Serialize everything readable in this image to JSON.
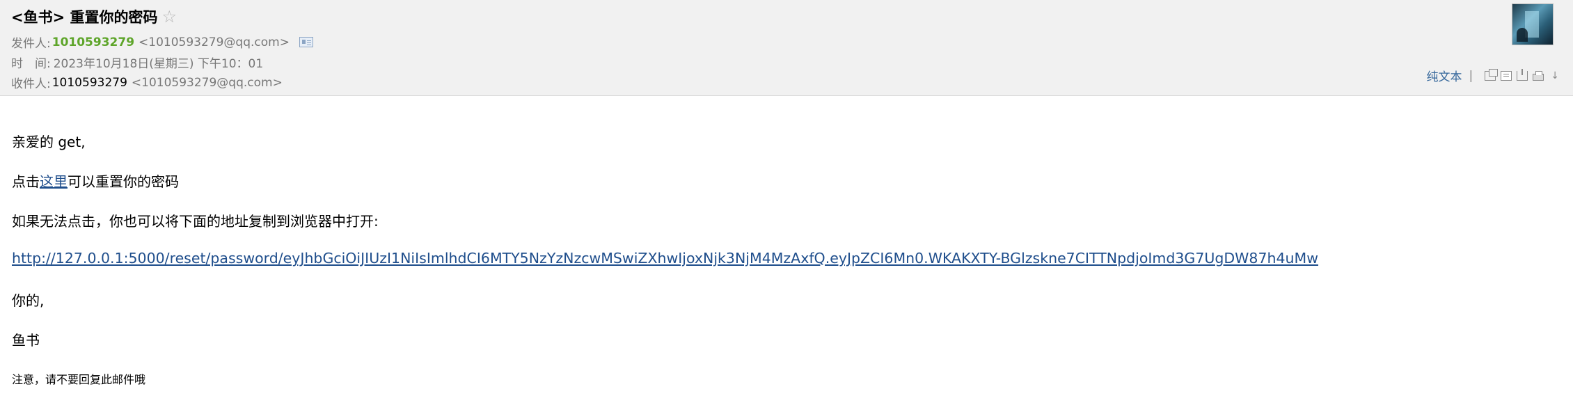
{
  "header": {
    "subject": "<鱼书> 重置你的密码",
    "star_icon": "☆",
    "from_label": "发件人:",
    "from_name": "1010593279",
    "from_addr": "<1010593279@qq.com>",
    "time_label": "时　间:",
    "time_value": "2023年10月18日(星期三) 下午10：01",
    "to_label": "收件人:",
    "to_name": "1010593279",
    "to_addr": "<1010593279@qq.com>"
  },
  "toolbar": {
    "plain_text": "纯文本",
    "separator": "|",
    "icons": [
      "new-window-icon",
      "page-icon",
      "export-icon",
      "print-icon",
      "chevron-down-icon"
    ]
  },
  "body": {
    "greeting": "亲爱的 get,",
    "click_prefix": "点击",
    "click_link": "这里",
    "click_suffix": "可以重置你的密码",
    "fallback_text": "如果无法点击，你也可以将下面的地址复制到浏览器中打开:",
    "reset_url": "http://127.0.0.1:5000/reset/password/eyJhbGciOiJIUzI1NiIsImlhdCI6MTY5NzYzNzcwMSwiZXhwIjoxNjk3NjM4MzAxfQ.eyJpZCI6Mn0.WKAKXTY-BGlzskne7CITTNpdjoImd3G7UgDW87h4uMw",
    "closing": "你的,",
    "signature": "鱼书",
    "note": "注意，请不要回复此邮件哦"
  },
  "colors": {
    "sender_green": "#5ea52a",
    "link_blue": "#1f4e8c",
    "header_bg": "#f1f1f1"
  }
}
